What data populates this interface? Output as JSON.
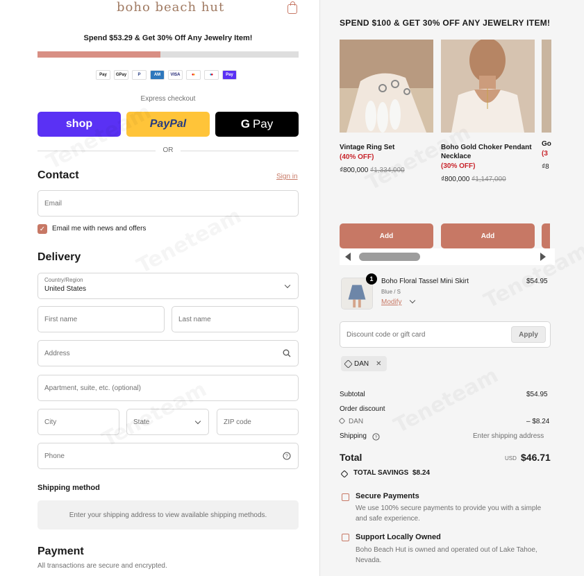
{
  "brand": {
    "logo": "boho beach hut"
  },
  "promo": {
    "text": "Spend $53.29 & Get 30% Off Any Jewelry Item!",
    "progress_fraction": 0.47
  },
  "payment_icons": [
    "Apple Pay",
    "Google Pay",
    "PayPal",
    "Amex",
    "Visa",
    "Mastercard",
    "Maestro",
    "Shop Pay"
  ],
  "express": {
    "label": "Express checkout",
    "shop_label": "shop",
    "paypal_label": "PayPal",
    "gpay_label": "Pay",
    "or_label": "OR"
  },
  "contact": {
    "title": "Contact",
    "signin_label": "Sign in",
    "email_placeholder": "Email",
    "newsletter_label": "Email me with news and offers"
  },
  "delivery": {
    "title": "Delivery",
    "country_label": "Country/Region",
    "country_value": "United States",
    "first_name_placeholder": "First name",
    "last_name_placeholder": "Last name",
    "address_placeholder": "Address",
    "apartment_placeholder": "Apartment, suite, etc. (optional)",
    "city_placeholder": "City",
    "state_placeholder": "State",
    "zip_placeholder": "ZIP code",
    "phone_placeholder": "Phone"
  },
  "shipping_method": {
    "title": "Shipping method",
    "message": "Enter your shipping address to view available shipping methods."
  },
  "payment": {
    "title": "Payment",
    "subtitle": "All transactions are secure and encrypted."
  },
  "upsell": {
    "title": "SPEND $100 & GET 30% OFF ANY JEWELRY ITEM!",
    "items": [
      {
        "name": "Vintage Ring Set",
        "discount": "(40% OFF)",
        "price": "₫800,000",
        "original_price": "₫1,334,000",
        "add_label": "Add"
      },
      {
        "name": "Boho Gold Choker Pendant Necklace",
        "discount": "(30% OFF)",
        "price": "₫800,000",
        "original_price": "₫1,147,000",
        "add_label": "Add"
      },
      {
        "name": "Go",
        "discount": "(3",
        "price": "₫8"
      }
    ]
  },
  "cart": {
    "item": {
      "name": "Boho Floral Tassel Mini Skirt",
      "variant": "Blue / S",
      "modify_label": "Modify",
      "price": "$54.95",
      "quantity": "1"
    },
    "discount_placeholder": "Discount code or gift card",
    "apply_label": "Apply",
    "applied_code": "DAN"
  },
  "summary": {
    "subtotal_label": "Subtotal",
    "subtotal_value": "$54.95",
    "order_discount_label": "Order discount",
    "discount_code": "DAN",
    "discount_value": "– $8.24",
    "shipping_label": "Shipping",
    "shipping_value": "Enter shipping address",
    "total_label": "Total",
    "currency": "USD",
    "total_value": "$46.71",
    "savings_label": "TOTAL SAVINGS",
    "savings_value": "$8.24"
  },
  "features": [
    {
      "title": "Secure Payments",
      "text": "We use 100% secure payments to provide you with a simple and safe experience."
    },
    {
      "title": "Support Locally Owned",
      "text": "Boho Beach Hut is owned and operated out of Lake Tahoe, Nevada."
    }
  ],
  "watermark": "Teneteam",
  "colors": {
    "accent": "#c77865",
    "shop": "#5a31f4",
    "paypal": "#ffc439",
    "gpay": "#000000",
    "sale": "#c8242b"
  }
}
